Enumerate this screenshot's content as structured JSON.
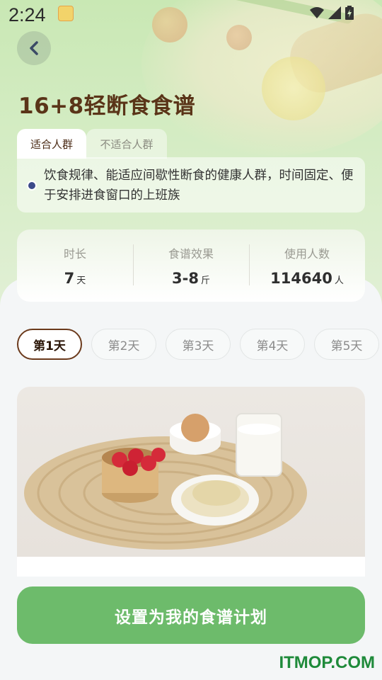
{
  "status_bar": {
    "time": "2:24"
  },
  "header": {
    "title": "16+8轻断食食谱"
  },
  "tabs": [
    {
      "label": "适合人群",
      "active": true
    },
    {
      "label": "不适合人群",
      "active": false
    }
  ],
  "description": "饮食规律、能适应间歇性断食的健康人群，时间固定、便于安排进食窗口的上班族",
  "stats": [
    {
      "label": "时长",
      "value": "7",
      "unit": "天"
    },
    {
      "label": "食谱效果",
      "value": "3-8",
      "unit": "斤"
    },
    {
      "label": "使用人数",
      "value": "114640",
      "unit": "人"
    }
  ],
  "days": [
    {
      "label": "第1天",
      "active": true
    },
    {
      "label": "第2天",
      "active": false
    },
    {
      "label": "第3天",
      "active": false
    },
    {
      "label": "第4天",
      "active": false
    },
    {
      "label": "第5天",
      "active": false
    }
  ],
  "cta": {
    "label": "设置为我的食谱计划"
  },
  "watermark": "ITMOP.COM",
  "colors": {
    "brand_green": "#6dbb6b",
    "title_brown": "#5a3418",
    "active_day_border": "#6b3a1c"
  }
}
